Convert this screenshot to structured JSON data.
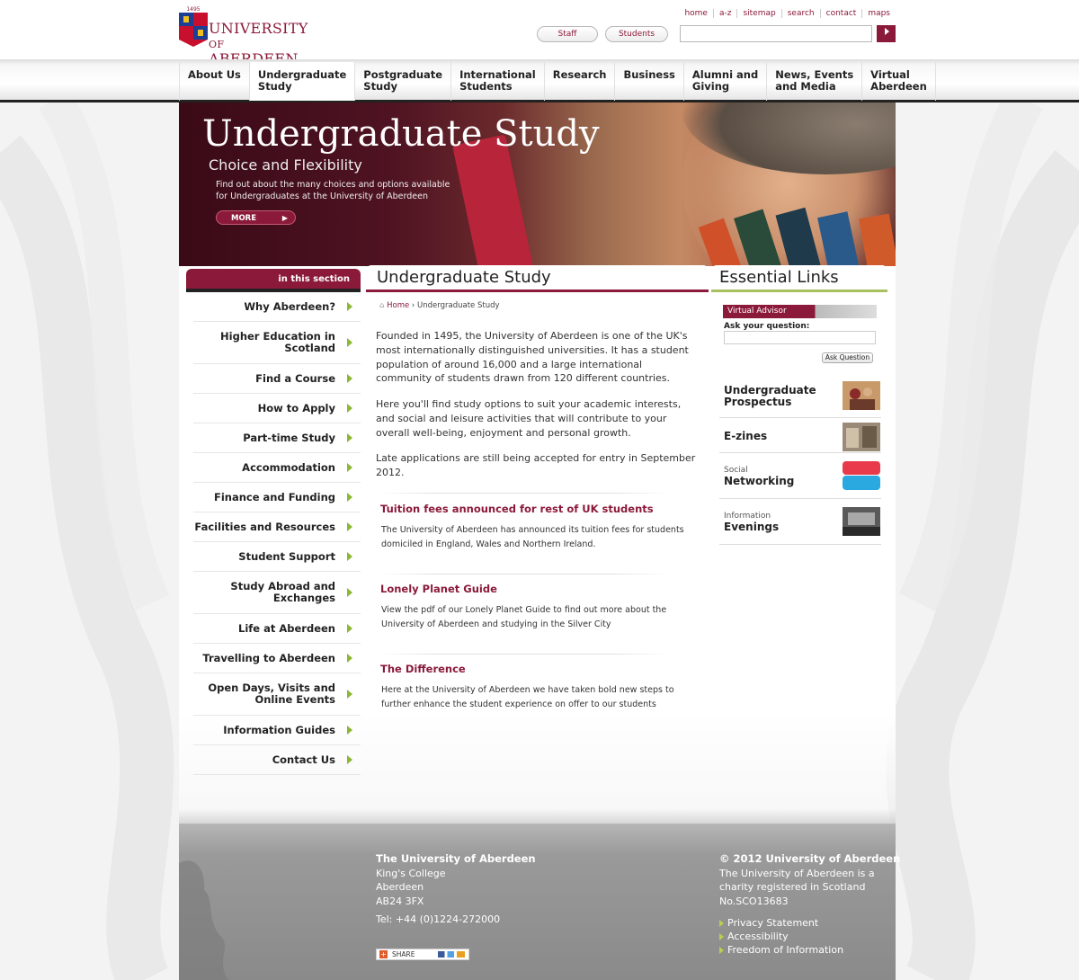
{
  "header": {
    "logo_line1": "UNIVERSITY",
    "logo_of": "OF",
    "logo_line2": "ABERDEEN",
    "logo_year": "1495",
    "top_links": [
      "home",
      "a-z",
      "sitemap",
      "search",
      "contact",
      "maps"
    ],
    "staff_label": "Staff",
    "students_label": "Students",
    "search_placeholder": "",
    "search_button_icon": "arrow-right-icon"
  },
  "nav": {
    "items": [
      {
        "line1": "About Us",
        "line2": ""
      },
      {
        "line1": "Undergraduate",
        "line2": "Study"
      },
      {
        "line1": "Postgraduate",
        "line2": "Study"
      },
      {
        "line1": "International",
        "line2": "Students"
      },
      {
        "line1": "Research",
        "line2": ""
      },
      {
        "line1": "Business",
        "line2": ""
      },
      {
        "line1": "Alumni and",
        "line2": "Giving"
      },
      {
        "line1": "News, Events",
        "line2": "and Media"
      },
      {
        "line1": "Virtual",
        "line2": "Aberdeen"
      }
    ],
    "active_index": 1
  },
  "hero": {
    "title": "Undergraduate Study",
    "subtitle": "Choice and Flexibility",
    "desc_line1": "Find out about the many choices and options available",
    "desc_line2": "for Undergraduates at the University of Aberdeen",
    "more_label": "MORE"
  },
  "sidebar": {
    "heading": "in this section",
    "items": [
      {
        "line1": "Why Aberdeen?",
        "line2": ""
      },
      {
        "line1": "Higher Education in",
        "line2": "Scotland"
      },
      {
        "line1": "Find a Course",
        "line2": ""
      },
      {
        "line1": "How to Apply",
        "line2": ""
      },
      {
        "line1": "Part-time Study",
        "line2": ""
      },
      {
        "line1": "Accommodation",
        "line2": ""
      },
      {
        "line1": "Finance and Funding",
        "line2": ""
      },
      {
        "line1": "Facilities and Resources",
        "line2": ""
      },
      {
        "line1": "Student Support",
        "line2": ""
      },
      {
        "line1": "Study Abroad and",
        "line2": "Exchanges"
      },
      {
        "line1": "Life at Aberdeen",
        "line2": ""
      },
      {
        "line1": "Travelling to Aberdeen",
        "line2": ""
      },
      {
        "line1": "Open Days, Visits and",
        "line2": "Online Events"
      },
      {
        "line1": "Information Guides",
        "line2": ""
      },
      {
        "line1": "Contact Us",
        "line2": ""
      }
    ]
  },
  "main": {
    "heading": "Undergraduate Study",
    "breadcrumb_home": "Home",
    "breadcrumb_sep": "›",
    "breadcrumb_current": "Undergraduate Study",
    "para1": "Founded in 1495, the University of Aberdeen is one of the UK's most internationally distinguished universities. It has a student population of around 16,000 and a large international community of students drawn from 120 different countries.",
    "para2": "Here you'll find study options to suit your academic interests, and social and leisure activities that will contribute to your overall well-being, enjoyment and personal growth.",
    "para3": "Late applications are still being accepted for entry in September 2012.",
    "news": [
      {
        "title": "Tuition fees announced for rest of UK students",
        "body": "The University of Aberdeen has announced its tuition fees for students domiciled in England, Wales and Northern Ireland."
      },
      {
        "title": "Lonely Planet Guide",
        "body": "View the pdf of our Lonely Planet Guide to find out more about the University of Aberdeen and studying in the Silver City"
      },
      {
        "title": "The Difference",
        "body": "Here at the University of Aberdeen we have taken bold new steps to further enhance the student experience on offer to our students"
      }
    ]
  },
  "essential": {
    "heading": "Essential Links",
    "va_title": "Virtual Advisor",
    "va_label": "Ask your question:",
    "va_button": "Ask Question",
    "links": [
      {
        "small": "",
        "big1": "Undergraduate",
        "big2": "Prospectus"
      },
      {
        "small": "",
        "big1": "E-zines",
        "big2": ""
      },
      {
        "small": "Social",
        "big1": "Networking",
        "big2": ""
      },
      {
        "small": "Information",
        "big1": "Evenings",
        "big2": ""
      }
    ]
  },
  "footer": {
    "org": "The University of Aberdeen",
    "addr1": "King's College",
    "addr2": "Aberdeen",
    "addr3": "AB24 3FX",
    "tel": "Tel: +44 (0)1224-272000",
    "copyright": "© 2012 University of Aberdeen",
    "charity1": "The University of Aberdeen is a",
    "charity2": "charity registered in Scotland",
    "charity3": "No.SCO13683",
    "links": [
      "Privacy Statement",
      "Accessibility",
      "Freedom of Information"
    ],
    "share_label": "SHARE"
  },
  "colors": {
    "brand": "#8b1a3a",
    "accent_green": "#8ab832"
  }
}
